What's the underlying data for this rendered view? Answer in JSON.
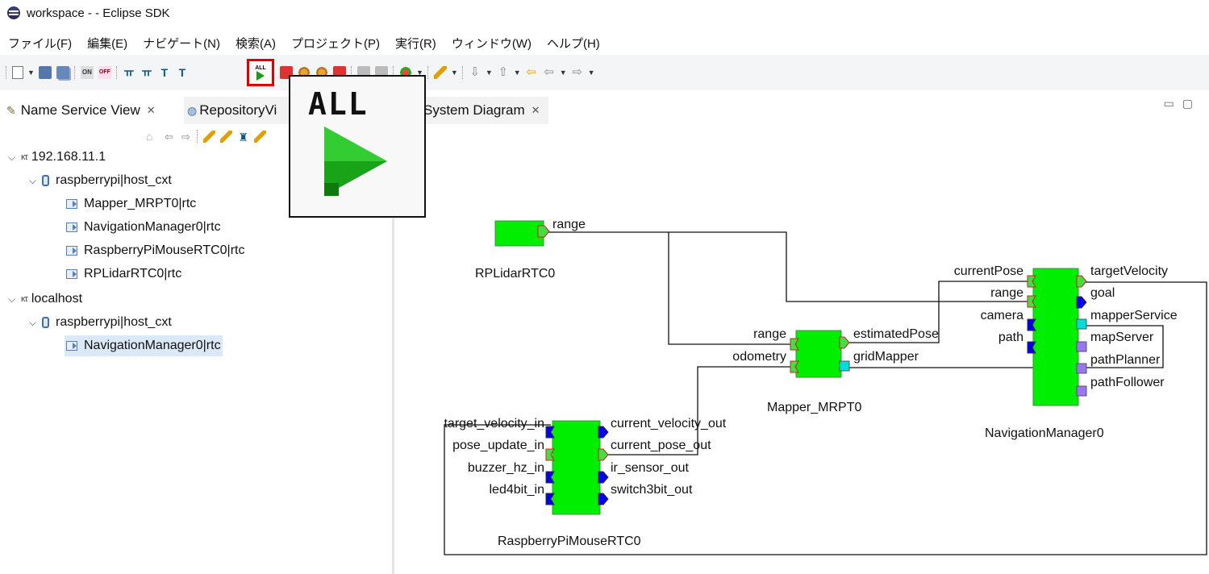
{
  "window": {
    "title": "workspace -  - Eclipse SDK"
  },
  "menu": [
    "ファイル(F)",
    "編集(E)",
    "ナビゲート(N)",
    "検索(A)",
    "プロジェクト(P)",
    "実行(R)",
    "ウィンドウ(W)",
    "ヘルプ(H)"
  ],
  "toolbar": {
    "runall_label": "ALL"
  },
  "tooltip": {
    "text": "ALL"
  },
  "tabs": {
    "name_service": "Name Service View",
    "repository": "RepositoryVi",
    "system_diagram": "System Diagram",
    "close_glyph": "✕"
  },
  "tree": {
    "ns1": {
      "name": "192.168.11.1",
      "icon": "κτ"
    },
    "ctx1": "raspberrypi|host_cxt",
    "ns1_rtcs": [
      "Mapper_MRPT0|rtc",
      "NavigationManager0|rtc",
      "RaspberryPiMouseRTC0|rtc",
      "RPLidarRTC0|rtc"
    ],
    "ns2": {
      "name": "localhost",
      "icon": "κτ"
    },
    "ctx2": "raspberrypi|host_cxt",
    "ns2_rtcs": [
      "NavigationManager0|rtc"
    ]
  },
  "diagram": {
    "rplidar": {
      "name": "RPLidarRTC0",
      "out": [
        "range"
      ]
    },
    "mapper": {
      "name": "Mapper_MRPT0",
      "in": [
        "range",
        "odometry"
      ],
      "out": [
        "estimatedPose",
        "gridMapper"
      ]
    },
    "navigation": {
      "name": "NavigationManager0",
      "in": [
        "currentPose",
        "range",
        "camera",
        "path"
      ],
      "out": [
        "targetVelocity",
        "goal",
        "mapperService",
        "mapServer",
        "pathPlanner",
        "pathFollower"
      ]
    },
    "raspi": {
      "name": "RaspberryPiMouseRTC0",
      "in": [
        "target_velocity_in",
        "pose_update_in",
        "buzzer_hz_in",
        "led4bit_in"
      ],
      "out": [
        "current_velocity_out",
        "current_pose_out",
        "ir_sensor_out",
        "switch3bit_out"
      ]
    },
    "colors": {
      "component": "#00ee00",
      "dataport": "#11aa11",
      "service_provided": "#00dddd",
      "service_required": "#9977ee",
      "port_blue": "#0000ee"
    }
  }
}
